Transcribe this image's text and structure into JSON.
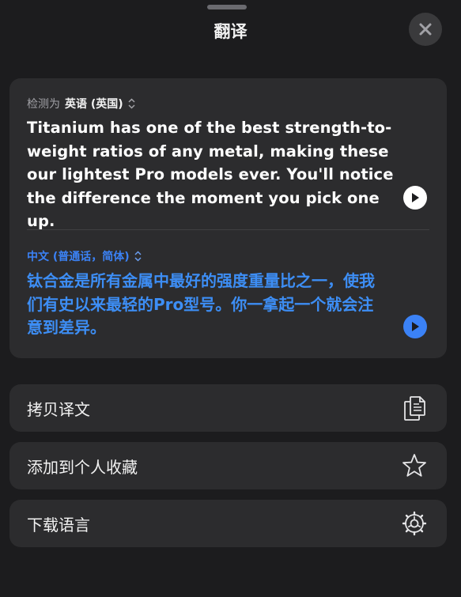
{
  "sheet": {
    "title": "翻译"
  },
  "source": {
    "detect_prefix": "检测为",
    "language": "英语 (英国)",
    "text": "Titanium has one of the best strength-to-weight ratios of any metal, making these our lightest Pro models ever. You'll notice the difference the moment you pick one up."
  },
  "target": {
    "language": "中文 (普通话，简体)",
    "text": "钛合金是所有金属中最好的强度重量比之一，使我们有史以来最轻的Pro型号。你一拿起一个就会注意到差异。"
  },
  "actions": [
    {
      "label": "拷贝译文",
      "icon": "copy-icon"
    },
    {
      "label": "添加到个人收藏",
      "icon": "star-icon"
    },
    {
      "label": "下载语言",
      "icon": "gear-icon"
    }
  ],
  "colors": {
    "background": "#1c1c1e",
    "card": "#2c2c2e",
    "accent": "#3b82f6"
  }
}
